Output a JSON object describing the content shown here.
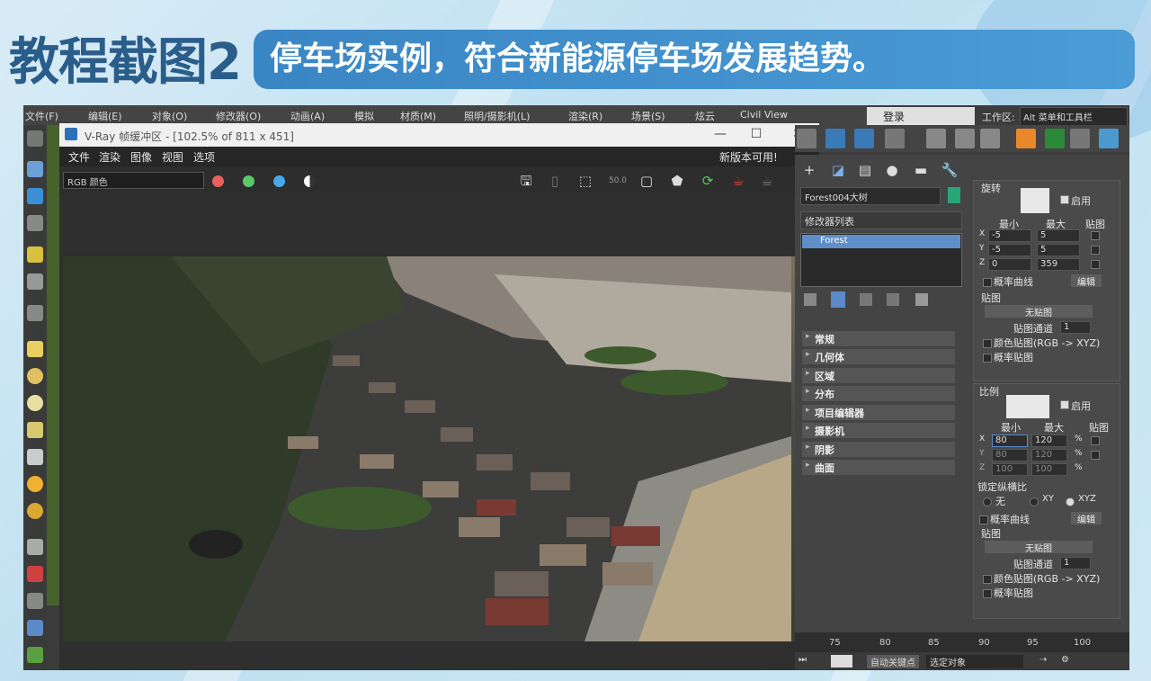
{
  "header": {
    "title": "教程截图2",
    "banner": "停车场实例，符合新能源停车场发展趋势。"
  },
  "menubar": [
    "文件(F)",
    "编辑(E)",
    "对象(O)",
    "修改器(O)",
    "动画(A)",
    "模拟",
    "材质(M)",
    "照明/摄影机(L)",
    "渲染(R)",
    "场景(S)",
    "炫云",
    "Civil View"
  ],
  "login_label": "登录",
  "workspace": {
    "label": "工作区:",
    "value": "Alt 菜单和工具栏"
  },
  "vfb": {
    "title": "V-Ray 帧缓冲区 - [102.5% of 811 x 451]",
    "menu": [
      "文件",
      "渲染",
      "图像",
      "视图",
      "选项"
    ],
    "update_notice": "新版本可用!",
    "channel": "RGB 颜色",
    "zoom_label": "50.0"
  },
  "command_panel": {
    "object_name": "Forest004大树",
    "modifier_list": "修改器列表",
    "stack_item": "Forest",
    "rollouts": [
      "常规",
      "几何体",
      "区域",
      "分布",
      "项目编辑器",
      "摄影机",
      "阴影",
      "曲面"
    ],
    "rotation": {
      "title": "旋转",
      "enable": "启用",
      "min": "最小",
      "max": "最大",
      "map": "贴图",
      "x_min": "-5",
      "x_max": "5",
      "y_min": "-5",
      "y_max": "5",
      "z_min": "0",
      "z_max": "359",
      "prob_curve": "概率曲线",
      "edit": "编辑",
      "map_label": "贴图",
      "no_map": "无贴图",
      "map_channel": "贴图通道",
      "map_channel_val": "1",
      "color_map": "颜色贴图(RGB -> XYZ)",
      "prob_map": "概率贴图"
    },
    "scale": {
      "title": "比例",
      "enable": "启用",
      "min": "最小",
      "max": "最大",
      "map": "贴图",
      "x_min": "80",
      "x_max": "120",
      "y_min": "80",
      "y_max": "120",
      "z_min": "100",
      "z_max": "100",
      "pct": "%",
      "lock": "锁定纵横比",
      "none": "无",
      "xy": "XY",
      "xyz": "XYZ",
      "prob_curve": "概率曲线",
      "edit": "编辑",
      "map_label": "贴图",
      "no_map": "无贴图",
      "map_channel": "贴图通道",
      "map_channel_val": "1",
      "color_map": "颜色贴图(RGB -> XYZ)",
      "prob_map": "概率贴图"
    }
  },
  "timeline_ticks": [
    "75",
    "80",
    "85",
    "90",
    "95",
    "100"
  ],
  "bottombar": {
    "autokey": "自动关键点",
    "selected": "选定对象"
  }
}
